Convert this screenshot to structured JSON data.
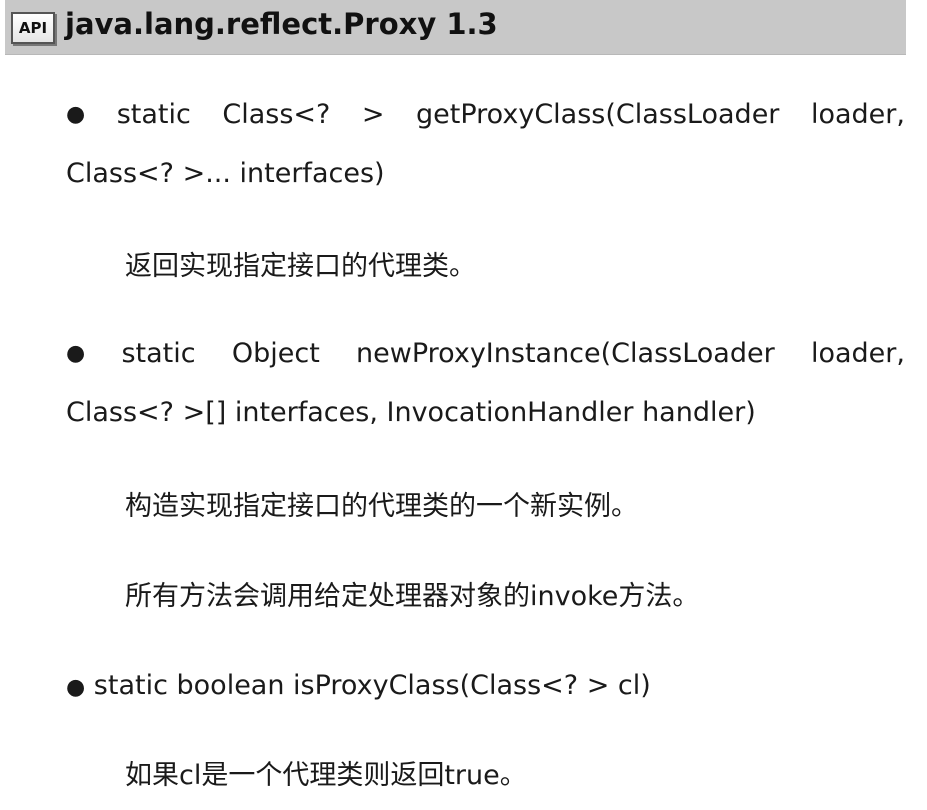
{
  "header": {
    "icon_label": "API",
    "title": "java.lang.reflect.Proxy 1.3"
  },
  "methods": [
    {
      "bullet": "●",
      "line1": [
        "static",
        "Class<?",
        ">",
        "getProxyClass(ClassLoader",
        "loader,"
      ],
      "line2": "Class<? >... interfaces)",
      "descriptions": [
        "返回实现指定接口的代理类。"
      ]
    },
    {
      "bullet": "●",
      "line1": [
        "static",
        "Object",
        "newProxyInstance(ClassLoader",
        "loader,"
      ],
      "line2": "Class<? >[] interfaces, InvocationHandler handler)",
      "descriptions": [
        "构造实现指定接口的代理类的一个新实例。",
        "所有方法会调用给定处理器对象的invoke方法。"
      ]
    },
    {
      "bullet": "●",
      "line1_text": "static boolean isProxyClass(Class<? > cl)",
      "descriptions": [
        "如果cl是一个代理类则返回true。"
      ]
    }
  ]
}
